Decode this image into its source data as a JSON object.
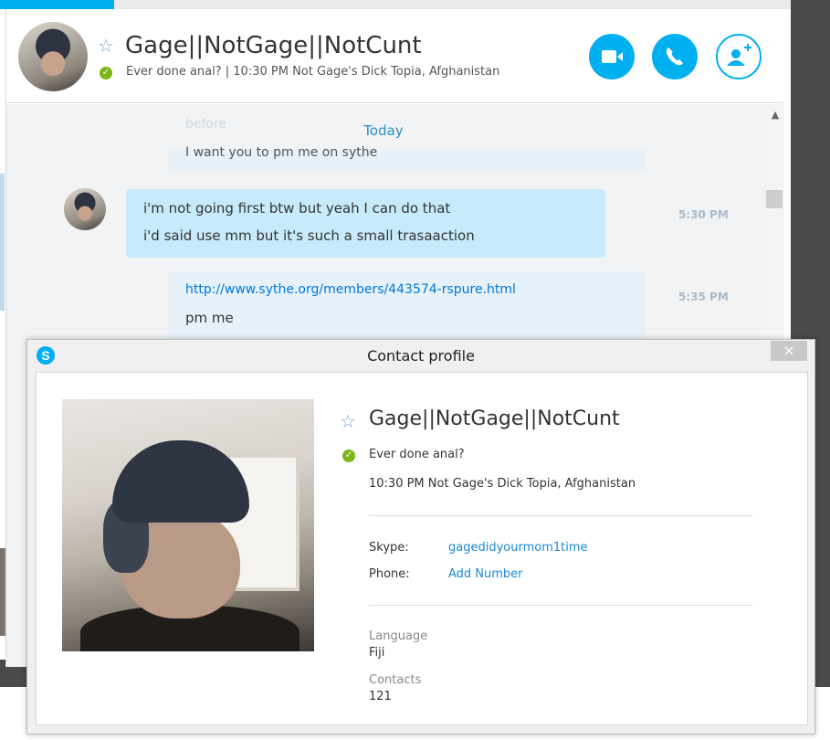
{
  "conversation": {
    "contact_name": "Gage||NotGage||NotCunt",
    "mood_and_location": "Ever done anal?  |  10:30 PM Not Gage's Dick Topia, Afghanistan",
    "buttons": {
      "video_icon": "video-camera-icon",
      "call_icon": "phone-icon",
      "add_icon": "add-person-icon"
    },
    "faded_before": "before",
    "date_separator": "Today",
    "faded_message": "I want you to pm me on sythe",
    "messages": [
      {
        "lines": [
          "i'm not going first btw but yeah I can do that",
          "i'd said use mm but it's such a small trasaaction"
        ],
        "time": "5:30 PM"
      },
      {
        "link": "http://www.sythe.org/members/443574-rspure.html",
        "lines": [
          "pm me"
        ],
        "time": "5:35 PM"
      }
    ]
  },
  "profile_dialog": {
    "title": "Contact profile",
    "logo_letter": "S",
    "close": "×",
    "name": "Gage||NotGage||NotCunt",
    "mood": "Ever done anal?",
    "location": "10:30 PM Not Gage's Dick Topia, Afghanistan",
    "skype_label": "Skype:",
    "skype_value": "gagedidyourmom1time",
    "phone_label": "Phone:",
    "phone_value": "Add Number",
    "language_label": "Language",
    "language_value": "Fiji",
    "contacts_label": "Contacts",
    "contacts_value": "121"
  },
  "colors": {
    "skype_blue": "#00aff0",
    "incoming_bubble": "#c7ebfb",
    "outgoing_bubble": "#e6f1fa",
    "online_green": "#7cb518",
    "link_blue": "#1a8ad4"
  }
}
